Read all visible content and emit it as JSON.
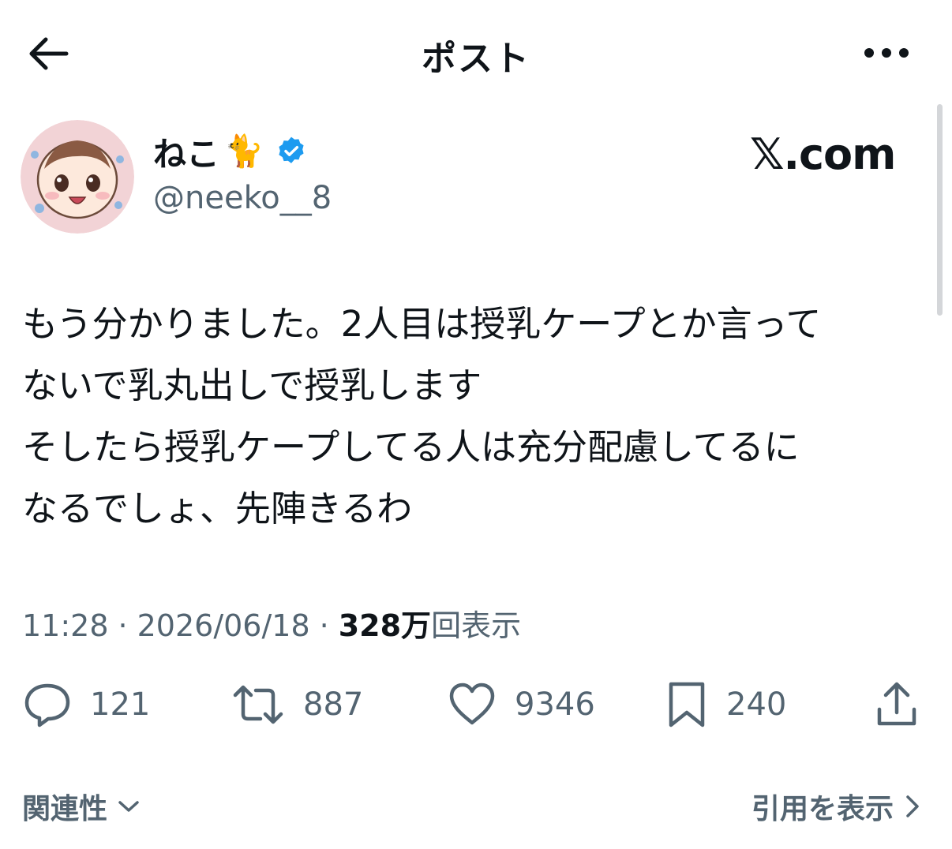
{
  "header": {
    "title": "ポスト"
  },
  "author": {
    "name": "ねこ",
    "emoji": "🐈",
    "handle": "@neeko__8"
  },
  "watermark": "𝕏.com",
  "post": {
    "text": "もう分かりました。2人目は授乳ケープとか言って\nないで乳丸出しで授乳します\nそしたら授乳ケープしてる人は充分配慮してるに\nなるでしょ、先陣きるわ"
  },
  "meta": {
    "time": "11:28",
    "date": "2026/06/18",
    "separator": "·",
    "views_count": "328万",
    "views_label": "回表示"
  },
  "actions": {
    "replies": "121",
    "reposts": "887",
    "likes": "9346",
    "bookmarks": "240"
  },
  "footer": {
    "relevance": "関連性",
    "view_quotes": "引用を表示"
  },
  "colors": {
    "text": "#0f1419",
    "secondary": "#536471",
    "verified": "#1d9bf0"
  }
}
